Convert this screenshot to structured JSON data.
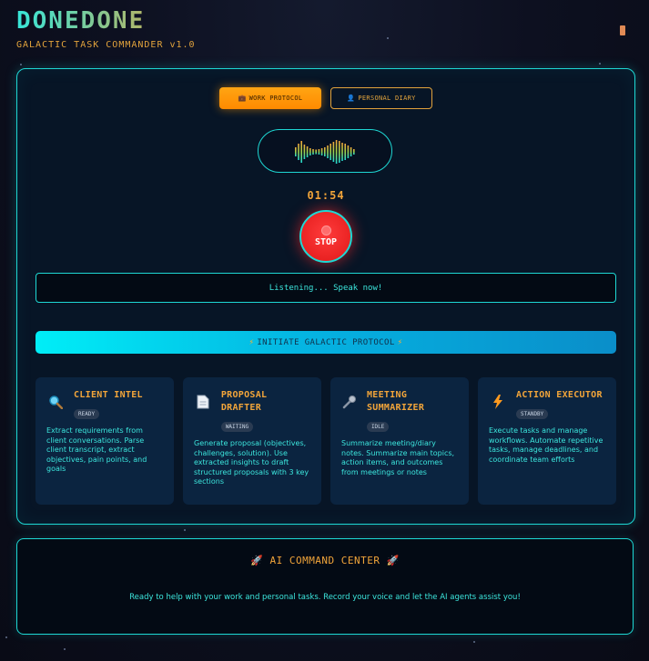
{
  "header": {
    "title": "DONEDONE",
    "subtitle": "GALACTIC TASK COMMANDER v1.0"
  },
  "tabs": [
    {
      "label": "WORK PROTOCOL",
      "icon": "briefcase-icon",
      "active": true
    },
    {
      "label": "PERSONAL DIARY",
      "icon": "person-icon",
      "active": false
    }
  ],
  "recorder": {
    "timer": "01:54",
    "stop_label": "STOP",
    "status": "Listening... Speak now!"
  },
  "initiate_label": "INITIATE GALACTIC PROTOCOL",
  "agents": [
    {
      "title": "CLIENT INTEL",
      "status": "READY",
      "icon": "magnifier-icon",
      "description": "Extract requirements from client conversations. Parse client transcript, extract objectives, pain points, and goals"
    },
    {
      "title": "PROPOSAL DRAFTER",
      "status": "WAITING",
      "icon": "document-icon",
      "description": "Generate proposal (objectives, challenges, solution). Use extracted insights to draft structured proposals with 3 key sections"
    },
    {
      "title": "MEETING SUMMARIZER",
      "status": "IDLE",
      "icon": "microphone-icon",
      "description": "Summarize meeting/diary notes. Summarize main topics, action items, and outcomes from meetings or notes"
    },
    {
      "title": "ACTION EXECUTOR",
      "status": "STANDBY",
      "icon": "lightning-icon",
      "description": "Execute tasks and manage workflows. Automate repetitive tasks, manage deadlines, and coordinate team efforts"
    }
  ],
  "command_center": {
    "title": "AI COMMAND CENTER",
    "message": "Ready to help with your work and personal tasks. Record your voice and let the AI agents assist you!"
  },
  "colors": {
    "accent_cyan": "#1ed8d4",
    "accent_orange": "#f2a53a",
    "stop_red": "#e01818"
  }
}
